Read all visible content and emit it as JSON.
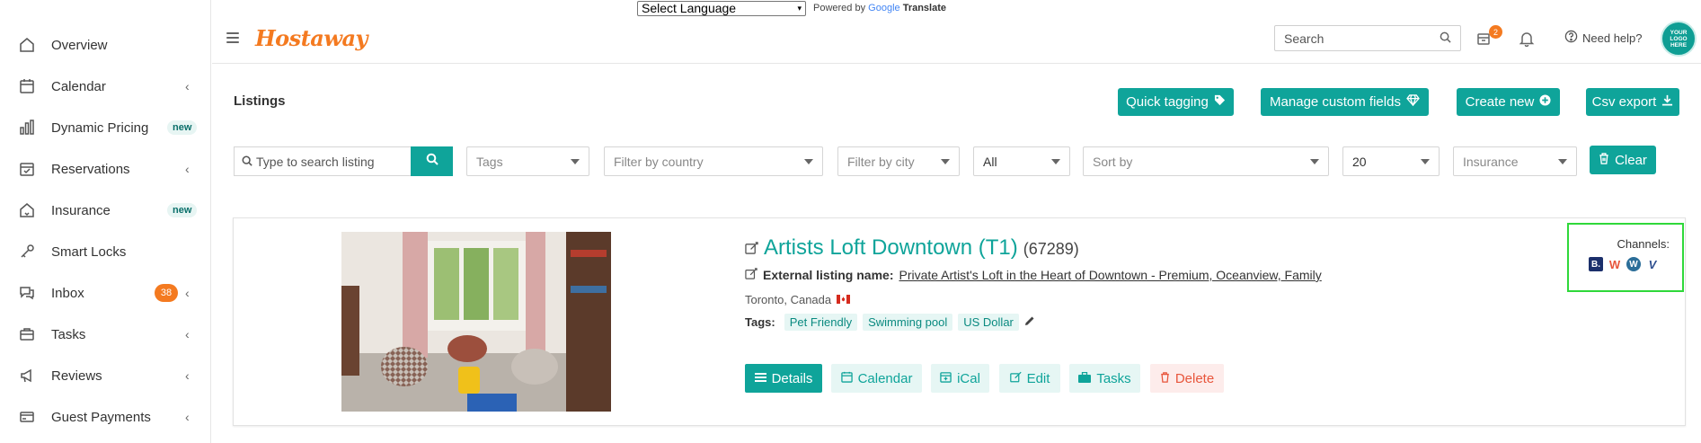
{
  "translate": {
    "select_label": "Select Language",
    "powered_by": "Powered by",
    "google": "Google",
    "translate": "Translate"
  },
  "sidebar": {
    "items": [
      {
        "label": "Overview",
        "icon": "home-icon"
      },
      {
        "label": "Calendar",
        "icon": "calendar-icon",
        "chevron": "‹"
      },
      {
        "label": "Dynamic Pricing",
        "icon": "bar-chart-icon",
        "badge": "new"
      },
      {
        "label": "Reservations",
        "icon": "calendar-check-icon",
        "chevron": "‹"
      },
      {
        "label": "Insurance",
        "icon": "house-shield-icon",
        "badge": "new"
      },
      {
        "label": "Smart Locks",
        "icon": "key-icon"
      },
      {
        "label": "Inbox",
        "icon": "chat-icon",
        "count": "38",
        "chevron": "‹"
      },
      {
        "label": "Tasks",
        "icon": "briefcase-icon",
        "chevron": "‹"
      },
      {
        "label": "Reviews",
        "icon": "megaphone-icon",
        "chevron": "‹"
      },
      {
        "label": "Guest Payments",
        "icon": "card-icon",
        "chevron": "‹"
      }
    ]
  },
  "header": {
    "logo": "Hostaway",
    "search_placeholder": "Search",
    "cart_badge": "2",
    "help_label": "Need help?",
    "avatar_text": "YOUR LOGO HERE"
  },
  "page": {
    "title": "Listings",
    "buttons": {
      "quick_tagging": "Quick tagging",
      "manage_custom_fields": "Manage custom fields",
      "create_new": "Create new",
      "csv_export": "Csv export"
    }
  },
  "filters": {
    "search_placeholder": "Type to search listing",
    "tags": "Tags",
    "country": "Filter by country",
    "city": "Filter by city",
    "status": "All",
    "sort": "Sort by",
    "per_page": "20",
    "insurance": "Insurance",
    "clear": "Clear"
  },
  "listing": {
    "title": "Artists Loft Downtown (T1)",
    "id": "(67289)",
    "external_label": "External listing name:",
    "external_name": "Private Artist's Loft in the Heart of Downtown - Premium, Oceanview, Family",
    "location": "Toronto, Canada",
    "tags_label": "Tags:",
    "tags": [
      "Pet Friendly",
      "Swimming pool",
      "US Dollar"
    ],
    "actions": {
      "details": "Details",
      "calendar": "Calendar",
      "ical": "iCal",
      "edit": "Edit",
      "tasks": "Tasks",
      "delete": "Delete"
    },
    "channels_label": "Channels:",
    "channels": [
      {
        "letter": "B.",
        "color": "#1b2f6b",
        "icon": "booking-icon"
      },
      {
        "letter": "W",
        "color": "#e8553b",
        "icon": "w-channel-icon"
      },
      {
        "letter": "W",
        "color": "#2b6e99",
        "icon": "wordpress-icon"
      },
      {
        "letter": "V",
        "color": "#2f4f8f",
        "icon": "vrbo-icon"
      }
    ]
  },
  "colors": {
    "accent": "#0fa49a",
    "brand": "#f47a20",
    "danger": "#e8553b"
  }
}
